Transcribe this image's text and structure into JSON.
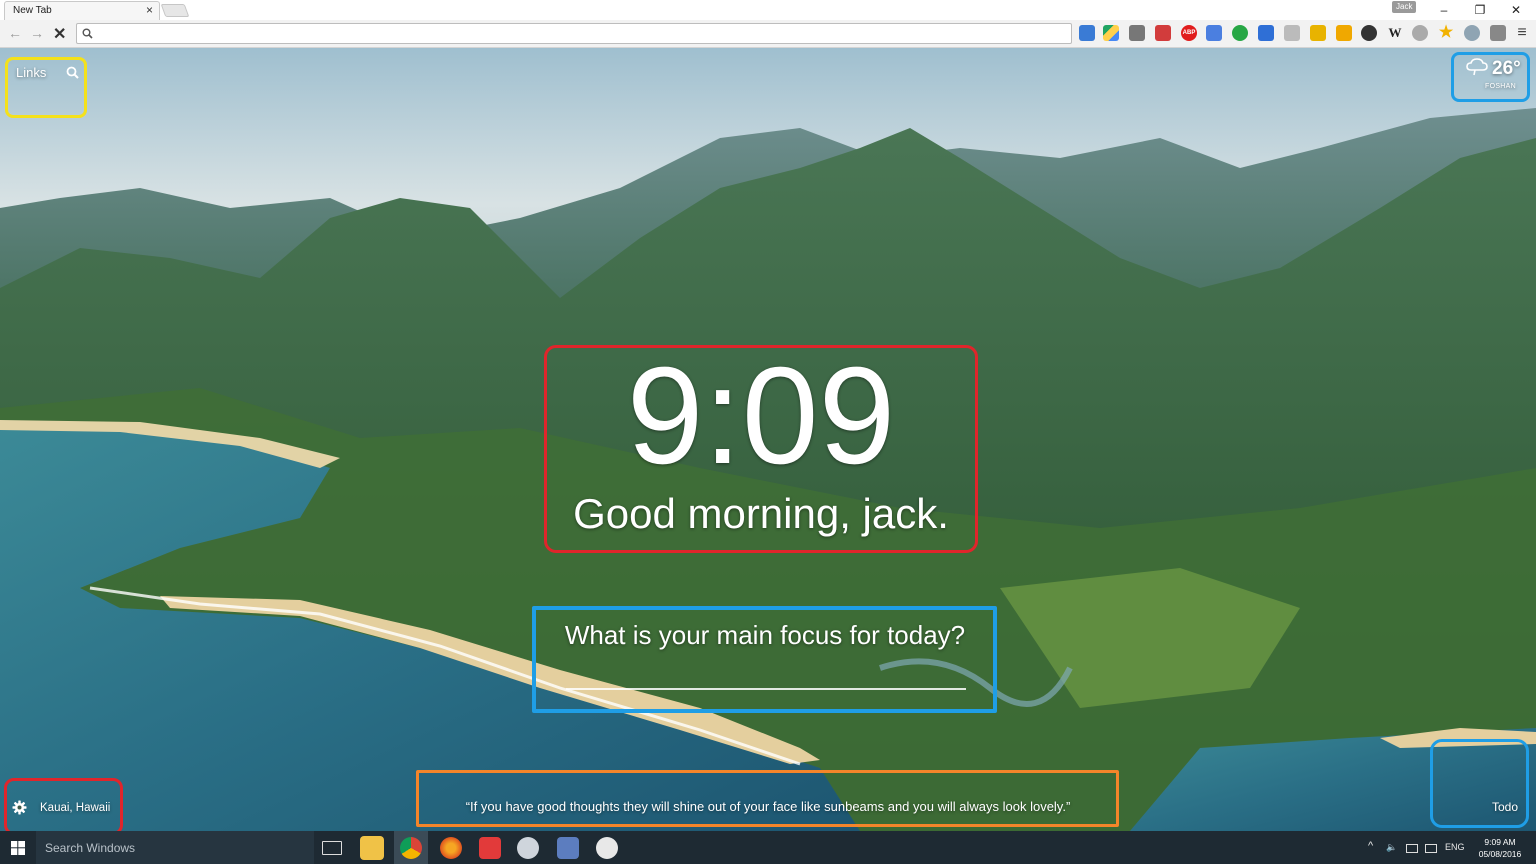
{
  "browser": {
    "tab_title": "New Tab",
    "tab_close": "×",
    "user_badge": "Jack",
    "omnibox_value": "",
    "window_controls": {
      "minimize": "–",
      "restore": "❐",
      "close": "✕"
    },
    "nav": {
      "back": "←",
      "forward": "→",
      "stop": "✕"
    },
    "menu_icon": "≡",
    "extensions": [
      "ext-icon",
      "google-drive-icon",
      "ext-icon",
      "bookmark-icon",
      "adblock-plus-icon",
      "translate-icon",
      "ext-icon",
      "ext-icon",
      "ext-icon",
      "ext-icon",
      "ext-icon",
      "ext-icon",
      "wikipedia-icon",
      "compass-icon",
      "star-icon",
      "globe-icon",
      "ext-icon"
    ],
    "ext_labels": {
      "abp": "ABP",
      "wiki": "W"
    }
  },
  "momentum": {
    "links_label": "Links",
    "weather": {
      "temperature": "26°",
      "location": "FOSHAN",
      "icon": "cloud-rain-icon"
    },
    "clock": "9:09",
    "greeting": "Good morning, jack.",
    "focus_question": "What is your main focus for today?",
    "focus_value": "",
    "location": "Kauai, Hawaii",
    "quote": "“If you have good thoughts they will shine out of your face like sunbeams and you will always look lovely.”",
    "todo_label": "Todo"
  },
  "annotations": {
    "colors": {
      "red": "#e0252b",
      "blue": "#1f9ee6",
      "yellow": "#f4e11b",
      "orange": "#f4852a"
    }
  },
  "taskbar": {
    "search_placeholder": "Search Windows",
    "language": "ENG",
    "time": "9:09 AM",
    "date": "05/08/2016"
  }
}
